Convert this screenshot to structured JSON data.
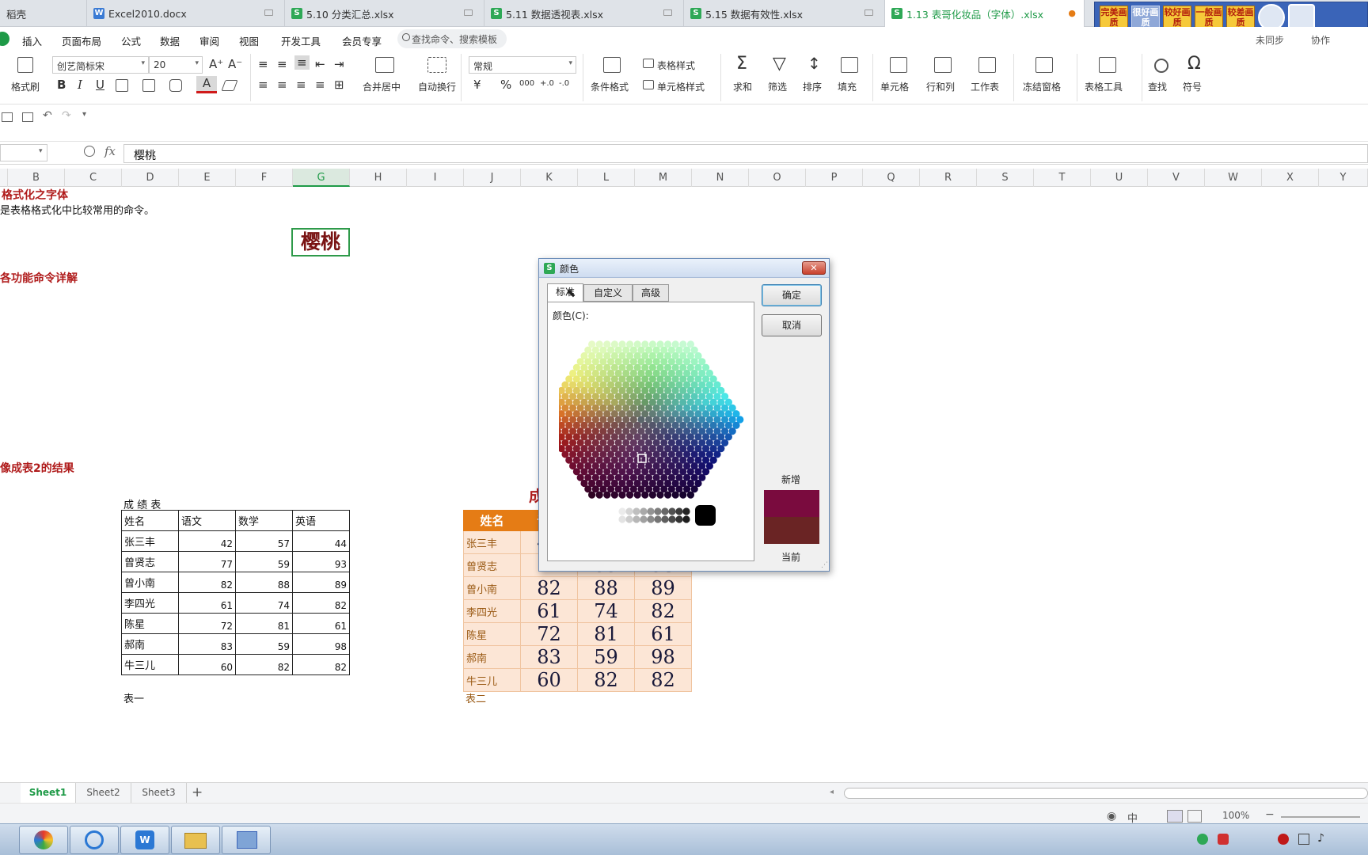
{
  "doc_tabs": [
    {
      "label": "稻壳",
      "type": "home"
    },
    {
      "label": "Excel2010.docx",
      "type": "w"
    },
    {
      "label": "5.10 分类汇总.xlsx",
      "type": "s"
    },
    {
      "label": "5.11 数据透视表.xlsx",
      "type": "s"
    },
    {
      "label": "5.15 数据有效性.xlsx",
      "type": "s"
    },
    {
      "label": "1.13 表哥化妆品（字体）.xlsx",
      "type": "s",
      "active": true
    }
  ],
  "quality_badges": [
    "完美画质",
    "很好画质",
    "较好画质",
    "一般画质",
    "较差画质"
  ],
  "menu": {
    "items": [
      "插入",
      "页面布局",
      "公式",
      "数据",
      "审阅",
      "视图",
      "开发工具",
      "会员专享"
    ],
    "search_placeholder": "查找命令、搜索模板",
    "sync": "未同步",
    "collab": "协作"
  },
  "toolbar": {
    "format_painter": "格式刷",
    "font_name": "创艺简标宋",
    "font_size": "20",
    "merge_center": "合并居中",
    "auto_wrap": "自动换行",
    "number_format": "常规",
    "conditional_format": "条件格式",
    "table_style": "表格样式",
    "cell_style": "单元格样式",
    "sum": "求和",
    "filter": "筛选",
    "sort": "排序",
    "fill": "填充",
    "cell": "单元格",
    "row_col": "行和列",
    "worksheet": "工作表",
    "freeze": "冻结窗格",
    "table_tools": "表格工具",
    "find": "查找",
    "symbol": "符号",
    "currency_symbol": "¥",
    "percent_symbol": "%",
    "thousands_symbol": "000",
    "dec_increase": "+.0",
    "dec_decrease": "-.0",
    "bold": "B",
    "italic": "I",
    "underline": "U",
    "grow_font": "A⁺",
    "shrink_font": "A⁻",
    "font_color": "A"
  },
  "formula_bar": {
    "fx": "fx",
    "value": "樱桃"
  },
  "columns": [
    "B",
    "C",
    "D",
    "E",
    "F",
    "G",
    "H",
    "I",
    "J",
    "K",
    "L",
    "M",
    "N",
    "O",
    "P",
    "Q",
    "R",
    "S",
    "T",
    "U",
    "V",
    "W",
    "X",
    "Y"
  ],
  "selected_column": "G",
  "sheet": {
    "title1": "格式化之字体",
    "subtitle1": "是表格格式化中比较常用的命令。",
    "cherry": "樱桃",
    "title2": "各功能命令详解",
    "title3": "像成表2的结果",
    "table1_caption": "成 绩 表",
    "table1_footer": "表一",
    "table2_caption": "成",
    "table2_footer": "表二",
    "headers": [
      "姓名",
      "语文",
      "数学",
      "英语"
    ],
    "rows": [
      {
        "name": "张三丰",
        "chinese": "42",
        "math": "57",
        "english": "44"
      },
      {
        "name": "曾贤志",
        "chinese": "77",
        "math": "59",
        "english": "93"
      },
      {
        "name": "曾小南",
        "chinese": "82",
        "math": "88",
        "english": "89"
      },
      {
        "name": "李四光",
        "chinese": "61",
        "math": "74",
        "english": "82"
      },
      {
        "name": "陈星",
        "chinese": "72",
        "math": "81",
        "english": "61"
      },
      {
        "name": "郝南",
        "chinese": "83",
        "math": "59",
        "english": "98"
      },
      {
        "name": "牛三儿",
        "chinese": "60",
        "math": "82",
        "english": "82"
      }
    ]
  },
  "dialog": {
    "title": "颜色",
    "tabs": [
      "标准",
      "自定义",
      "高级"
    ],
    "colors_label": "颜色(C):",
    "ok": "确定",
    "cancel": "取消",
    "new_label": "新增",
    "current_label": "当前",
    "new_color": "#7a0b3e",
    "current_color": "#6a2424"
  },
  "sheet_tabs": [
    "Sheet1",
    "Sheet2",
    "Sheet3"
  ],
  "status": {
    "zoom": "100%"
  },
  "colors": {
    "accent": "#1e9a47",
    "orange_header": "#e57c15",
    "title_red": "#b01c1c"
  }
}
